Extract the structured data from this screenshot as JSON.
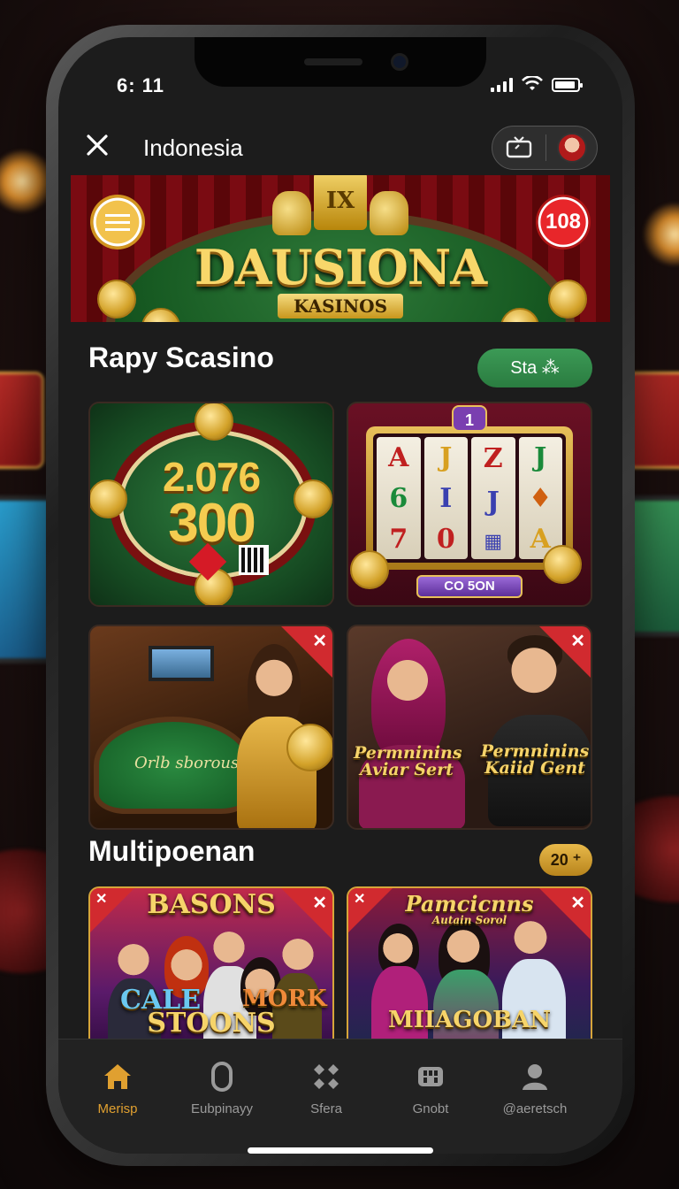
{
  "status_bar": {
    "time": "6: 11"
  },
  "header": {
    "title": "Indonesia"
  },
  "hero": {
    "brand": "DAUSIONA",
    "subtitle": "KASINOS",
    "crown_mark": "IX",
    "badge_number": "108"
  },
  "section1": {
    "title": "Rapy Scasino",
    "action_label": "Sta ⁂"
  },
  "tiles_row1": {
    "jackpot_line1": "2.076",
    "jackpot_line2": "300",
    "slot_badge": "1",
    "slot_button": "CO 5ON",
    "slot_reels": [
      [
        "A",
        "6",
        "7"
      ],
      [
        "J",
        "I",
        "0"
      ],
      [
        "Z",
        "J",
        "▦"
      ],
      [
        "J",
        "♦",
        "A"
      ]
    ]
  },
  "tiles_row2": {
    "left_table_text": "Orlb sborous",
    "right_caption_1": "Permninins Aviar Sert",
    "right_caption_2": "Permninins Kaiid Gent"
  },
  "section2": {
    "title": "Multipoenan",
    "count": "20 ⁺"
  },
  "tiles_row3": {
    "left_title": "BASONS",
    "left_sub_1": "CALE",
    "left_sub_2": "MORK",
    "left_sub_3": "STOONS",
    "right_title": "Pamcicnns",
    "right_title_small": "Autain Sorol",
    "right_sub": "MIIAGOBAN"
  },
  "nav": {
    "items": [
      {
        "label": "Merisp",
        "icon": "home-icon",
        "active": true
      },
      {
        "label": "Eubpinayy",
        "icon": "chip-icon",
        "active": false
      },
      {
        "label": "Sfera",
        "icon": "diamond-grid-icon",
        "active": false
      },
      {
        "label": "Gnobt",
        "icon": "apps-icon",
        "active": false
      },
      {
        "label": "@aeretsch",
        "icon": "profile-icon",
        "active": false
      }
    ]
  },
  "colors": {
    "accent_gold": "#e0a030",
    "action_green": "#3c9a56",
    "badge_red": "#d12a2f"
  }
}
